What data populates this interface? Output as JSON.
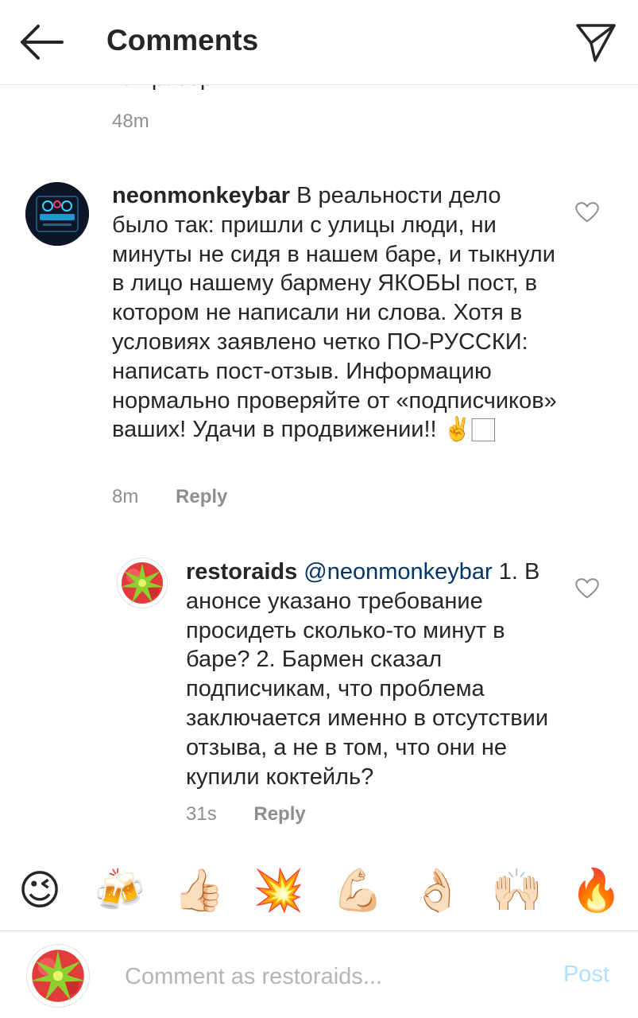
{
  "header": {
    "title": "Comments"
  },
  "previous": {
    "text": "так разорим!",
    "time": "48m"
  },
  "comments": [
    {
      "username": "neonmonkeybar",
      "text": "В реальности дело было так: пришли с улицы люди, ни минуты не сидя в нашем баре, и тыкнули в лицо нашему бармену ЯКОБЫ пост, в котором не написали ни слова. Хотя в условиях заявлено четко ПО-РУССКИ: написать пост-отзыв. Информацию нормально проверяйте от «подписчиков» ваших! Удачи в продвижении!! ✌️🏻",
      "time": "8m",
      "reply_label": "Reply"
    },
    {
      "username": "restoraids",
      "mention": "@neonmonkeybar",
      "text": "1. В анонсе указано требование просидеть сколько-то минут в баре? 2. Бармен сказал подписчикам, что проблема заключается именно в отсутствии отзыва, а не в том, что они не купили коктейль?",
      "time": "31s",
      "reply_label": "Reply"
    }
  ],
  "emojis": [
    "😉",
    "🍻",
    "👍🏻",
    "💥",
    "💪🏻",
    "👌🏻",
    "🙌🏻",
    "🔥"
  ],
  "input": {
    "placeholder": "Comment as restoraids...",
    "post_label": "Post"
  }
}
